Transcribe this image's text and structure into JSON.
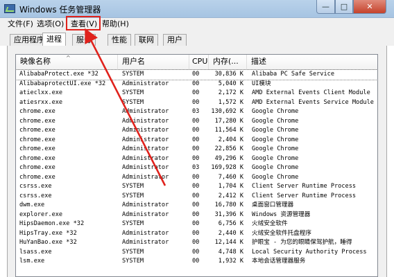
{
  "window": {
    "title": "Windows 任务管理器",
    "minimize": "—",
    "maximize": "□",
    "close": "✕"
  },
  "menu": [
    "文件(F)",
    "选项(O)",
    "查看(V)",
    "帮助(H)"
  ],
  "tabs": [
    "应用程序",
    "进程",
    "服务",
    "性能",
    "联网",
    "用户"
  ],
  "columns": {
    "name": "映像名称",
    "user": "用户名",
    "cpu": "CPU",
    "mem": "内存(...",
    "desc": "描述"
  },
  "scrollbar": {
    "up": "▲"
  },
  "processes": [
    {
      "name": "AlibabaProtect.exe *32",
      "user": "SYSTEM",
      "cpu": "00",
      "mem": "30,836 K",
      "desc": "Alibaba PC Safe Service"
    },
    {
      "name": "AlibabaprotectUI.exe *32",
      "user": "Administrator",
      "cpu": "00",
      "mem": "5,040 K",
      "desc": "UI模块"
    },
    {
      "name": "atieclxx.exe",
      "user": "SYSTEM",
      "cpu": "00",
      "mem": "2,172 K",
      "desc": "AMD External Events Client Module"
    },
    {
      "name": "atiesrxx.exe",
      "user": "SYSTEM",
      "cpu": "00",
      "mem": "1,572 K",
      "desc": "AMD External Events Service Module"
    },
    {
      "name": "chrome.exe",
      "user": "Administrator",
      "cpu": "03",
      "mem": "130,692 K",
      "desc": "Google Chrome"
    },
    {
      "name": "chrome.exe",
      "user": "Administrator",
      "cpu": "00",
      "mem": "17,280 K",
      "desc": "Google Chrome"
    },
    {
      "name": "chrome.exe",
      "user": "Administrator",
      "cpu": "00",
      "mem": "11,564 K",
      "desc": "Google Chrome"
    },
    {
      "name": "chrome.exe",
      "user": "Administrator",
      "cpu": "00",
      "mem": "2,404 K",
      "desc": "Google Chrome"
    },
    {
      "name": "chrome.exe",
      "user": "Administrator",
      "cpu": "00",
      "mem": "22,856 K",
      "desc": "Google Chrome"
    },
    {
      "name": "chrome.exe",
      "user": "Administrator",
      "cpu": "00",
      "mem": "49,296 K",
      "desc": "Google Chrome"
    },
    {
      "name": "chrome.exe",
      "user": "Administrator",
      "cpu": "03",
      "mem": "169,928 K",
      "desc": "Google Chrome"
    },
    {
      "name": "chrome.exe",
      "user": "Administrator",
      "cpu": "00",
      "mem": "7,460 K",
      "desc": "Google Chrome"
    },
    {
      "name": "csrss.exe",
      "user": "SYSTEM",
      "cpu": "00",
      "mem": "1,704 K",
      "desc": "Client Server Runtime Process"
    },
    {
      "name": "csrss.exe",
      "user": "SYSTEM",
      "cpu": "00",
      "mem": "2,412 K",
      "desc": "Client Server Runtime Process"
    },
    {
      "name": "dwm.exe",
      "user": "Administrator",
      "cpu": "00",
      "mem": "16,780 K",
      "desc": "桌面窗口管理器"
    },
    {
      "name": "explorer.exe",
      "user": "Administrator",
      "cpu": "00",
      "mem": "31,396 K",
      "desc": "Windows 资源管理器"
    },
    {
      "name": "HipsDaemon.exe *32",
      "user": "SYSTEM",
      "cpu": "00",
      "mem": "6,756 K",
      "desc": "火绒安全软件"
    },
    {
      "name": "HipsTray.exe *32",
      "user": "Administrator",
      "cpu": "00",
      "mem": "2,440 K",
      "desc": "火绒安全软件托盘程序"
    },
    {
      "name": "HuYanBao.exe *32",
      "user": "Administrator",
      "cpu": "00",
      "mem": "12,144 K",
      "desc": "护眼宝 - 为您的眼睛保驾护航，睡得"
    },
    {
      "name": "lsass.exe",
      "user": "SYSTEM",
      "cpu": "00",
      "mem": "4,748 K",
      "desc": "Local Security Authority Process"
    },
    {
      "name": "lsm.exe",
      "user": "SYSTEM",
      "cpu": "00",
      "mem": "1,932 K",
      "desc": "本地会话管理器服务"
    }
  ]
}
